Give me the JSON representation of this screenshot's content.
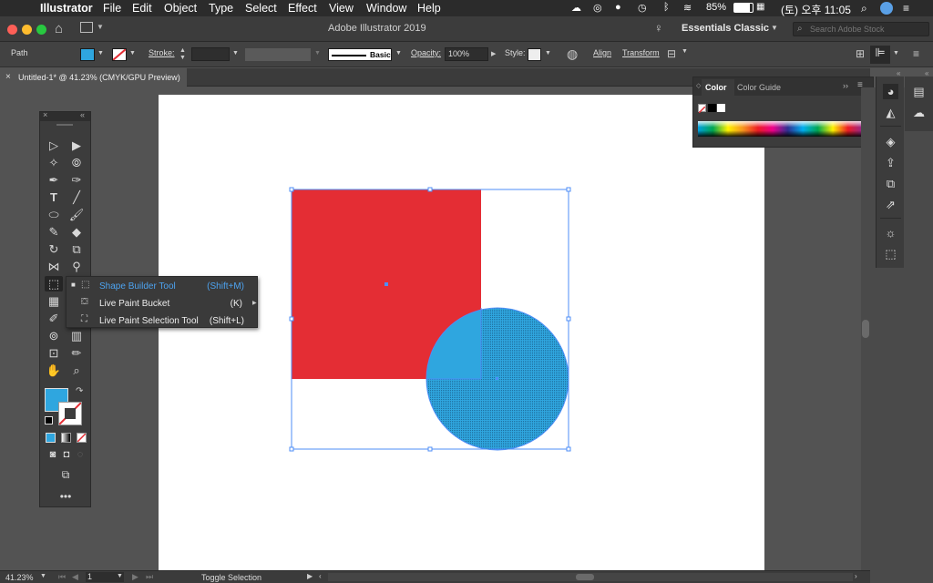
{
  "menubar": {
    "app": "Illustrator",
    "items": [
      "File",
      "Edit",
      "Object",
      "Type",
      "Select",
      "Effect",
      "View",
      "Window",
      "Help"
    ],
    "battery": "85%",
    "clock": "(토) 오후 11:05"
  },
  "titlebar": {
    "title": "Adobe Illustrator 2019",
    "workspace": "Essentials Classic",
    "search_placeholder": "Search Adobe Stock"
  },
  "control": {
    "selection": "Path",
    "stroke_label": "Stroke:",
    "brush": "Basic",
    "opacity_label": "Opacity:",
    "opacity_value": "100%",
    "style_label": "Style:",
    "align": "Align",
    "transform": "Transform"
  },
  "document_tab": {
    "title": "Untitled-1* @ 41.23% (CMYK/GPU Preview)"
  },
  "flyout": {
    "items": [
      {
        "label": "Shape Builder Tool",
        "shortcut": "(Shift+M)"
      },
      {
        "label": "Live Paint Bucket",
        "shortcut": "(K)"
      },
      {
        "label": "Live Paint Selection Tool",
        "shortcut": "(Shift+L)"
      }
    ]
  },
  "color_panel": {
    "tab_color": "Color",
    "tab_guide": "Color Guide"
  },
  "statusbar": {
    "zoom": "41.23%",
    "page": "1",
    "status": "Toggle Selection"
  },
  "colors": {
    "red": "#e42d34",
    "blue": "#2fa6df",
    "selection": "#4e8ef7"
  }
}
